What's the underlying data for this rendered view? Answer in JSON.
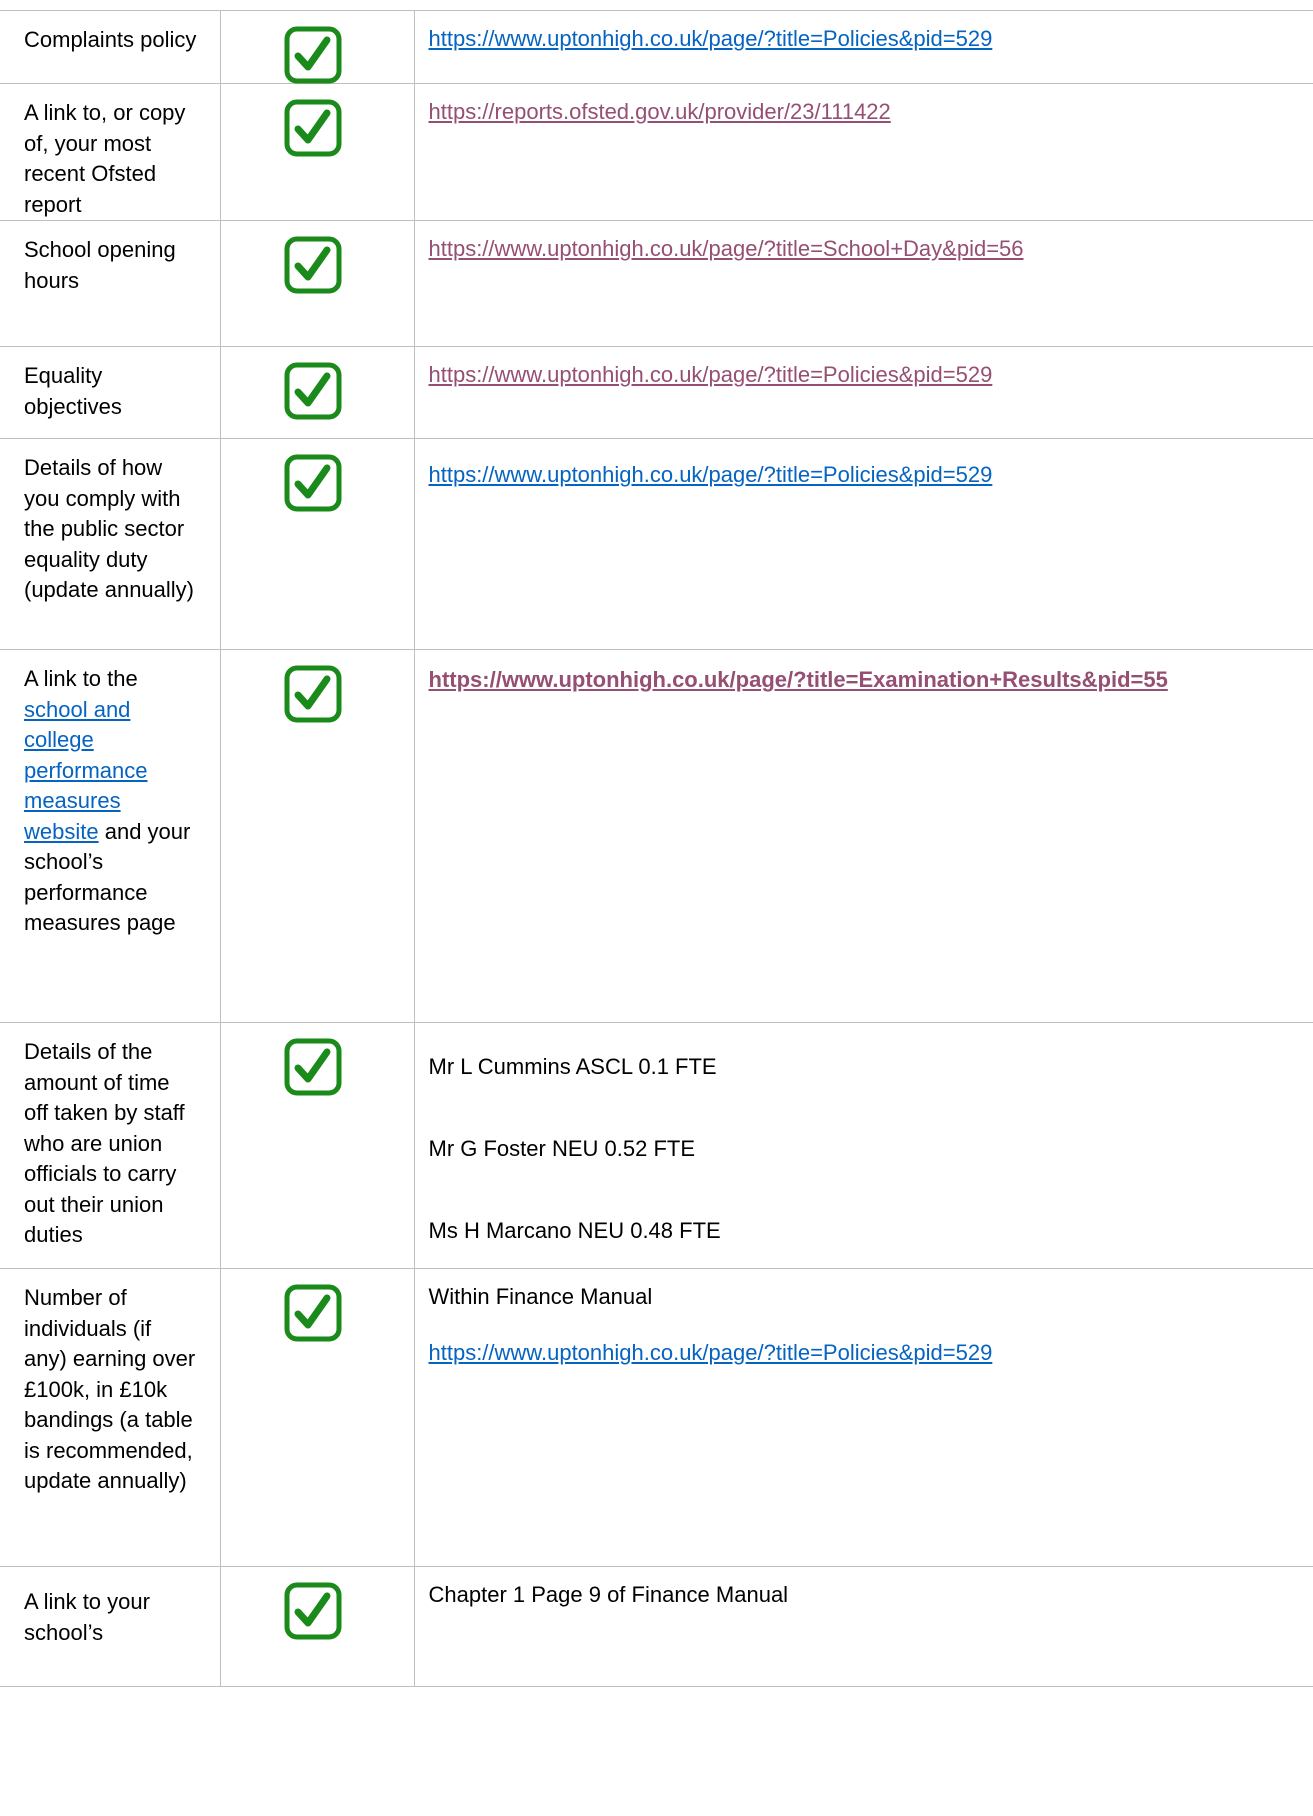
{
  "colors": {
    "link": "#0563c1",
    "visited_link": "#954f72",
    "check": "#1a8a1a",
    "border": "#bfbfbf"
  },
  "check_icon": "green-checkbox-icon",
  "rows": [
    {
      "label": "Complaints policy",
      "link": "https://www.uptonhigh.co.uk/page/?title=Policies&pid=529"
    },
    {
      "label": "A link to, or copy of, your most recent Ofsted report",
      "link": "https://reports.ofsted.gov.uk/provider/23/111422"
    },
    {
      "label": "School opening hours",
      "link": "https://www.uptonhigh.co.uk/page/?title=School+Day&pid=56"
    },
    {
      "label": "Equality objectives",
      "link": "https://www.uptonhigh.co.uk/page/?title=Policies&pid=529"
    },
    {
      "label": "Details of how you comply with the public sector equality duty (update annually)",
      "link": "https://www.uptonhigh.co.uk/page/?title=Policies&pid=529"
    },
    {
      "label_prefix": "A link to the",
      "label_link": "school and college performance measures website",
      "label_suffix": "and your school’s performance measures page",
      "link": "https://www.uptonhigh.co.uk/page/?title=Examination+Results&pid=55"
    },
    {
      "label": "Details of the amount of time off taken by staff who are union officials to carry out their union duties",
      "lines": [
        "Mr L Cummins ASCL 0.1 FTE",
        "Mr G Foster NEU 0.52 FTE",
        "Ms H Marcano NEU 0.48 FTE"
      ]
    },
    {
      "label": "Number of individuals (if any) earning over £100k, in £10k bandings (a table is recommended, update annually)",
      "text": "Within Finance Manual",
      "link": "https://www.uptonhigh.co.uk/page/?title=Policies&pid=529"
    },
    {
      "label": "A link to your school’s",
      "text": "Chapter 1 Page 9 of Finance Manual"
    }
  ]
}
